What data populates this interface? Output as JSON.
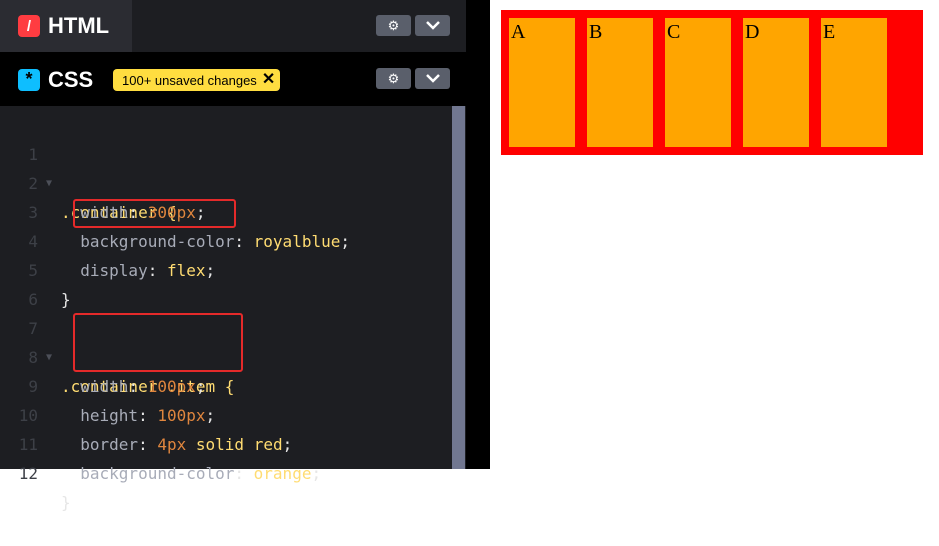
{
  "html_panel": {
    "title": "HTML",
    "icon": "html-icon",
    "settings_icon": "gear-icon",
    "collapse_icon": "chevron-down-icon"
  },
  "css_panel": {
    "title": "CSS",
    "icon": "css-icon",
    "badge": "100+ unsaved changes",
    "badge_close": "✕",
    "settings_icon": "gear-icon",
    "collapse_icon": "chevron-down-icon"
  },
  "code_lines": [
    {
      "n": "1",
      "text": ".container {"
    },
    {
      "n": "2",
      "text": "  width: 300px;"
    },
    {
      "n": "3",
      "text": "  background-color: royalblue;"
    },
    {
      "n": "4",
      "text": "  display: flex;"
    },
    {
      "n": "5",
      "text": "}"
    },
    {
      "n": "6",
      "text": ""
    },
    {
      "n": "7",
      "text": ".container .item {"
    },
    {
      "n": "8",
      "text": "  width: 100px;"
    },
    {
      "n": "9",
      "text": "  height: 100px;"
    },
    {
      "n": "10",
      "text": "  border: 4px solid red;"
    },
    {
      "n": "11",
      "text": "  background-color: orange;"
    },
    {
      "n": "12",
      "text": "}"
    }
  ],
  "preview": {
    "items": [
      "A",
      "B",
      "C",
      "D",
      "E"
    ]
  },
  "colors": {
    "highlight": "#e42a2a",
    "badge": "#ffdd40",
    "item_bg": "#ffa500",
    "item_border": "#ff0000"
  }
}
